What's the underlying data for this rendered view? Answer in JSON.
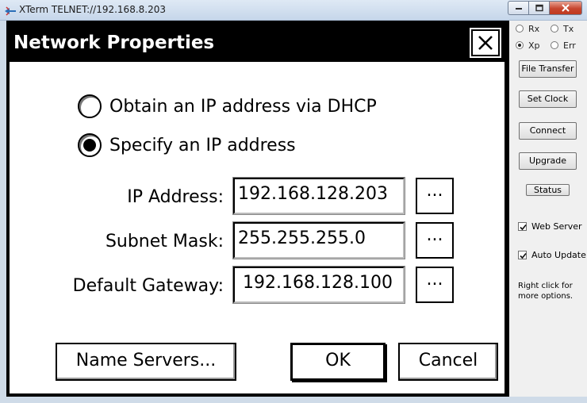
{
  "window": {
    "title": "XTerm TELNET://192.168.8.203"
  },
  "dialog": {
    "title": "Network Properties",
    "mode_options": [
      {
        "label": "Obtain an IP address via DHCP",
        "selected": false
      },
      {
        "label": "Specify an IP address",
        "selected": true
      }
    ],
    "fields": [
      {
        "label": "IP Address:",
        "value": "192.168.128.203",
        "browse_label": "..."
      },
      {
        "label": "Subnet Mask:",
        "value": "255.255.255.0",
        "browse_label": "..."
      },
      {
        "label": "Default Gateway:",
        "value": "192.168.128.100",
        "browse_label": "..."
      }
    ],
    "buttons": {
      "name_servers": "Name Servers...",
      "ok": "OK",
      "cancel": "Cancel"
    }
  },
  "panel": {
    "indicators": [
      {
        "label": "Rx",
        "selected": false
      },
      {
        "label": "Tx",
        "selected": false
      },
      {
        "label": "Xp",
        "selected": true
      },
      {
        "label": "Err",
        "selected": false
      }
    ],
    "buttons": {
      "file_transfer": "File Transfer",
      "set_clock": "Set Clock",
      "connect": "Connect",
      "upgrade": "Upgrade",
      "status": "Status"
    },
    "checkboxes": [
      {
        "label": "Web Server",
        "checked": true
      },
      {
        "label": "Auto Update",
        "checked": true
      }
    ],
    "hint": "Right click for more options."
  }
}
